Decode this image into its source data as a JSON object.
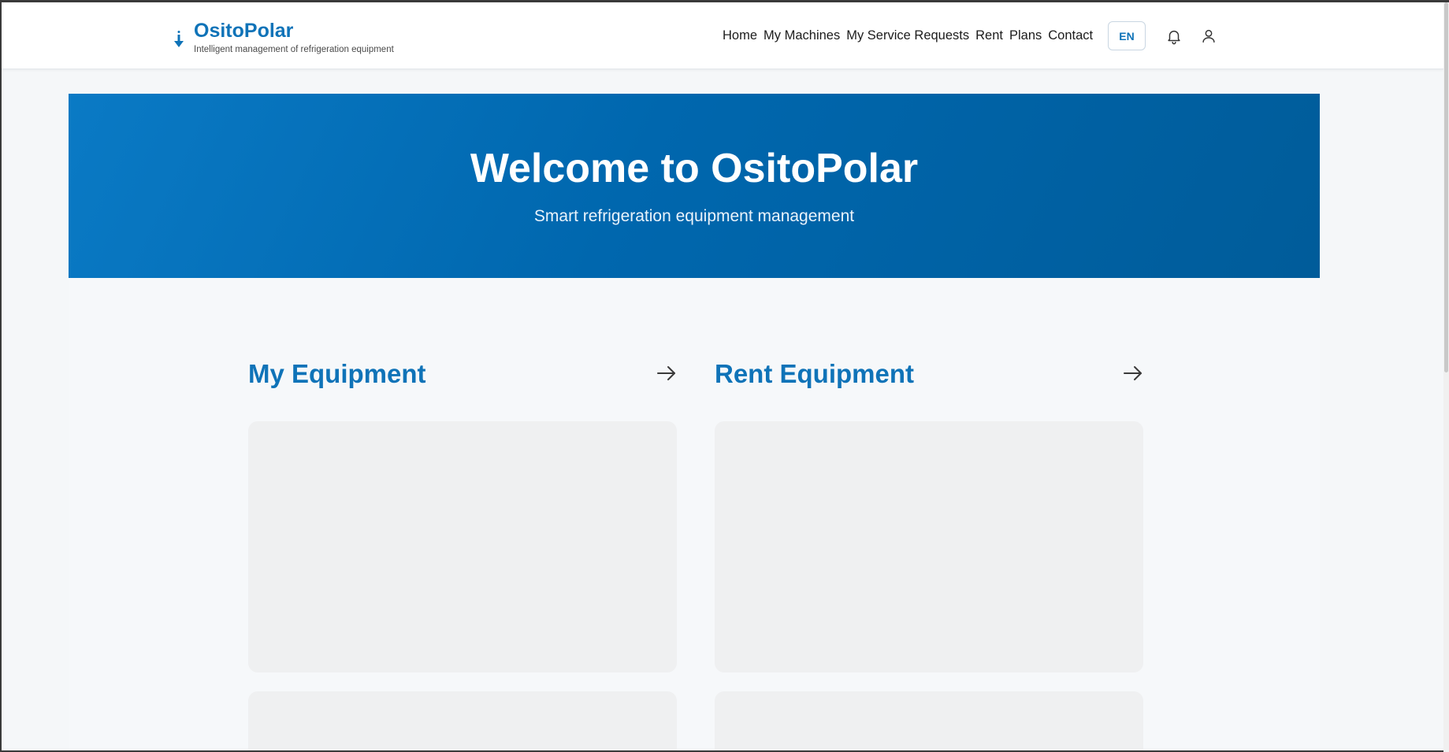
{
  "header": {
    "brand_name": "OsitoPolar",
    "brand_tagline": "Intelligent management of refrigeration equipment",
    "brand_icon": "thermometer-arrow-icon",
    "nav": [
      {
        "label": "Home"
      },
      {
        "label": "My Machines"
      },
      {
        "label": "My Service Requests"
      },
      {
        "label": "Rent"
      },
      {
        "label": "Plans"
      },
      {
        "label": "Contact"
      }
    ],
    "language": "EN",
    "notification_icon": "bell-icon",
    "profile_icon": "user-icon"
  },
  "hero": {
    "title": "Welcome to OsitoPolar",
    "subtitle": "Smart refrigeration equipment management"
  },
  "sections": [
    {
      "title": "My Equipment",
      "arrow_icon": "arrow-right-icon"
    },
    {
      "title": "Rent Equipment",
      "arrow_icon": "arrow-right-icon"
    }
  ],
  "colors": {
    "brand": "#0f73b8",
    "hero_start": "#0a7ac5",
    "hero_end": "#005c9a",
    "placeholder_card": "#eff0f1",
    "background": "#f5f7f9"
  }
}
